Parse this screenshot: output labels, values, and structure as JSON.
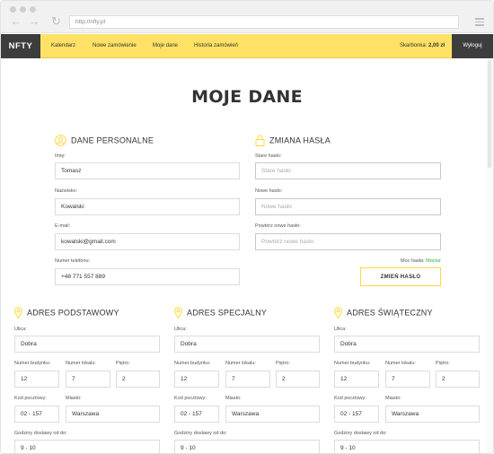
{
  "browser": {
    "url": "http://nfty.pl"
  },
  "nav": {
    "logo": "NFTY",
    "links": [
      "Kalendarz",
      "Nowe zamówienie",
      "Moje dane",
      "Historia zamówień"
    ],
    "balance_label": "Skarbonka:",
    "balance_value": "2,00 zł",
    "logout": "Wyloguj"
  },
  "page": {
    "title": "MOJE DANE"
  },
  "personal": {
    "heading": "DANE PERSONALNE",
    "first_name_label": "Imię:",
    "first_name": "Tomasz",
    "last_name_label": "Nazwisko:",
    "last_name": "Kowalski",
    "email_label": "E-mail:",
    "email": "kowalski@gmail.com",
    "phone_label": "Numer telefonu:",
    "phone": "+48 771 557 889"
  },
  "password": {
    "heading": "ZMIANA HASŁA",
    "old_label": "Stare hasło:",
    "old_placeholder": "Stare hasło",
    "new_label": "Nowe hasło:",
    "new_placeholder": "Nowe hasło",
    "repeat_label": "Powtórz nowe hasło:",
    "repeat_placeholder": "Powtórz nowe hasło",
    "strength_label": "Moc hasła:",
    "strength_value": "Mocne",
    "strength_color": "#27a54b",
    "submit": "ZMIEŃ HASŁO"
  },
  "addresses": [
    {
      "heading": "ADRES PODSTAWOWY",
      "street_label": "Ulica:",
      "street": "Dobra",
      "building_label": "Numer budynku:",
      "building": "12",
      "apartment_label": "Numer lokalu:",
      "apartment": "7",
      "floor_label": "Piętro:",
      "floor": "2",
      "postcode_label": "Kod pocztowy:",
      "postcode": "02 - 157",
      "city_label": "Miasto:",
      "city": "Warszawa",
      "hours_label": "Godziny dostawy od do:",
      "hours": "9 - 10"
    },
    {
      "heading": "ADRES SPECJALNY",
      "street_label": "Ulica:",
      "street": "Dobra",
      "building_label": "Numer budynku:",
      "building": "12",
      "apartment_label": "Numer lokalu:",
      "apartment": "7",
      "floor_label": "Piętro:",
      "floor": "2",
      "postcode_label": "Kod pocztowy:",
      "postcode": "02 - 157",
      "city_label": "Miasto:",
      "city": "Warszawa",
      "hours_label": "Godziny dostawy od do:",
      "hours": "9 - 10"
    },
    {
      "heading": "ADRES ŚWIĄTECZNY",
      "street_label": "Ulica:",
      "street": "Dobra",
      "building_label": "Numer budynku:",
      "building": "12",
      "apartment_label": "Numer lokalu:",
      "apartment": "7",
      "floor_label": "Piętro:",
      "floor": "2",
      "postcode_label": "Kod pocztowy:",
      "postcode": "02 - 157",
      "city_label": "Miasto:",
      "city": "Warszawa",
      "hours_label": "Godziny dostawy od do:",
      "hours": "9 - 10"
    }
  ],
  "colors": {
    "accent": "#ffe265",
    "dark": "#3d3d3d",
    "icon_yellow": "#ffd83a"
  },
  "icons": {
    "person": "user-icon",
    "lock": "lock-icon",
    "pin": "map-pin-icon"
  }
}
